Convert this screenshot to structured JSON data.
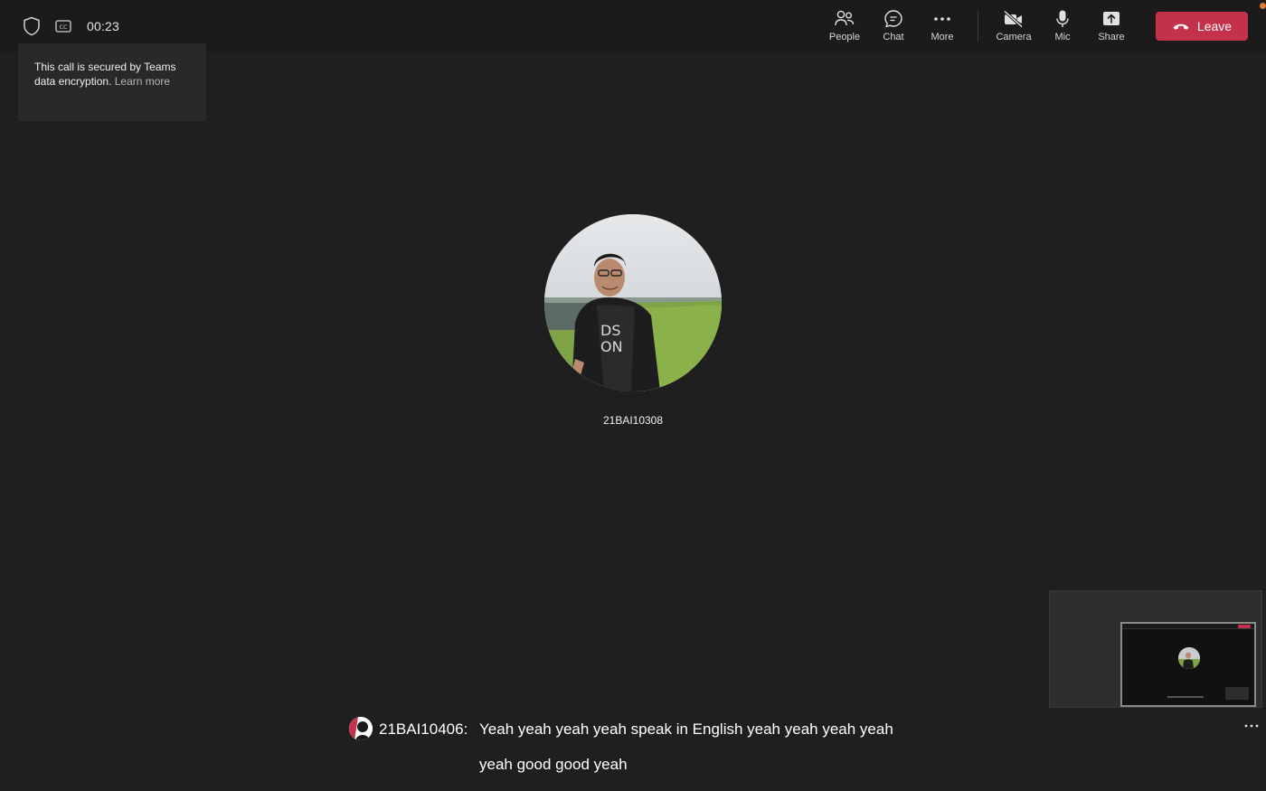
{
  "call": {
    "timer": "00:23"
  },
  "toolbar": {
    "people_label": "People",
    "chat_label": "Chat",
    "more_label": "More",
    "camera_label": "Camera",
    "mic_label": "Mic",
    "share_label": "Share",
    "leave_label": "Leave"
  },
  "encryption_tooltip": {
    "text": "This call is secured by Teams data encryption.",
    "link": "Learn more"
  },
  "participant": {
    "name": "21BAI10308"
  },
  "caption": {
    "speaker": "21BAI10406:",
    "line1": "Yeah yeah yeah yeah speak in English yeah yeah yeah yeah",
    "line2": "yeah good good yeah"
  },
  "colors": {
    "background": "#1f1f1f",
    "topbar": "#1b1b1b",
    "leave": "#c4314b"
  },
  "icons": [
    "shield-icon",
    "closed-captions-icon",
    "people-icon",
    "chat-icon",
    "more-icon",
    "camera-off-icon",
    "mic-icon",
    "share-icon",
    "phone-hangup-icon",
    "ellipsis-icon"
  ]
}
